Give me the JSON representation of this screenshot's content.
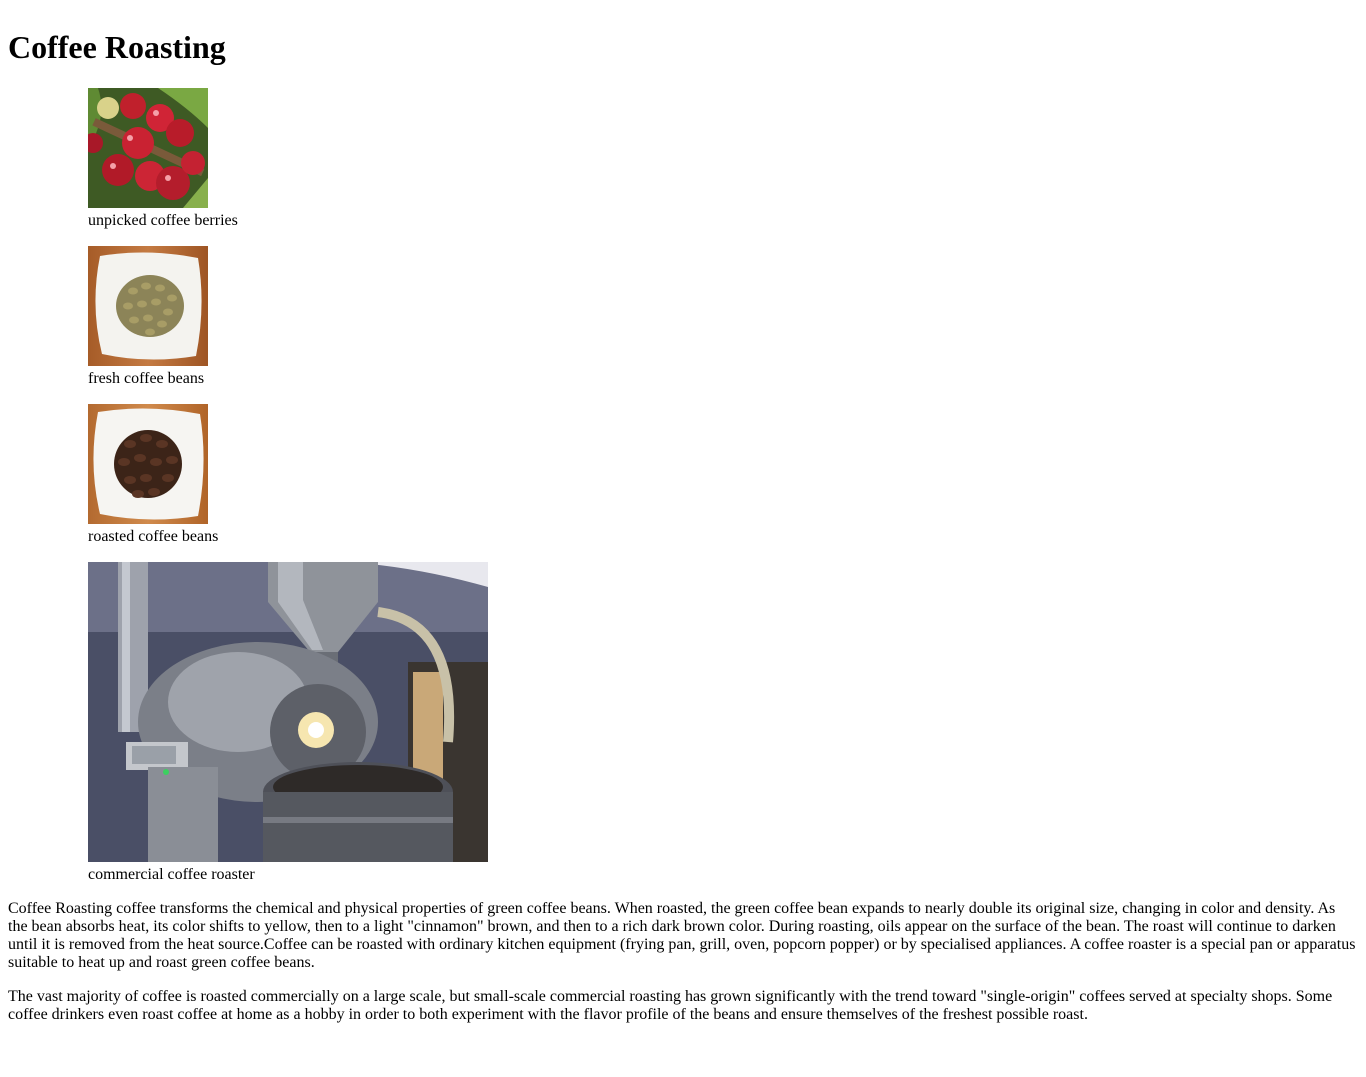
{
  "title": "Coffee Roasting",
  "figures": [
    {
      "caption": "unpicked coffee berries"
    },
    {
      "caption": "fresh coffee beans"
    },
    {
      "caption": "roasted coffee beans"
    },
    {
      "caption": "commercial coffee roaster"
    }
  ],
  "paragraphs": [
    "Coffee Roasting coffee transforms the chemical and physical properties of green coffee beans. When roasted, the green coffee bean expands to nearly double its original size, changing in color and density. As the bean absorbs heat, its color shifts to yellow, then to a light \"cinnamon\" brown, and then to a rich dark brown color. During roasting, oils appear on the surface of the bean. The roast will continue to darken until it is removed from the heat source.Coffee can be roasted with ordinary kitchen equipment (frying pan, grill, oven, popcorn popper) or by specialised appliances. A coffee roaster is a special pan or apparatus suitable to heat up and roast green coffee beans.",
    "The vast majority of coffee is roasted commercially on a large scale, but small-scale commercial roasting has grown significantly with the trend toward \"single-origin\" coffees served at specialty shops. Some coffee drinkers even roast coffee at home as a hobby in order to both experiment with the flavor profile of the beans and ensure themselves of the freshest possible roast."
  ]
}
